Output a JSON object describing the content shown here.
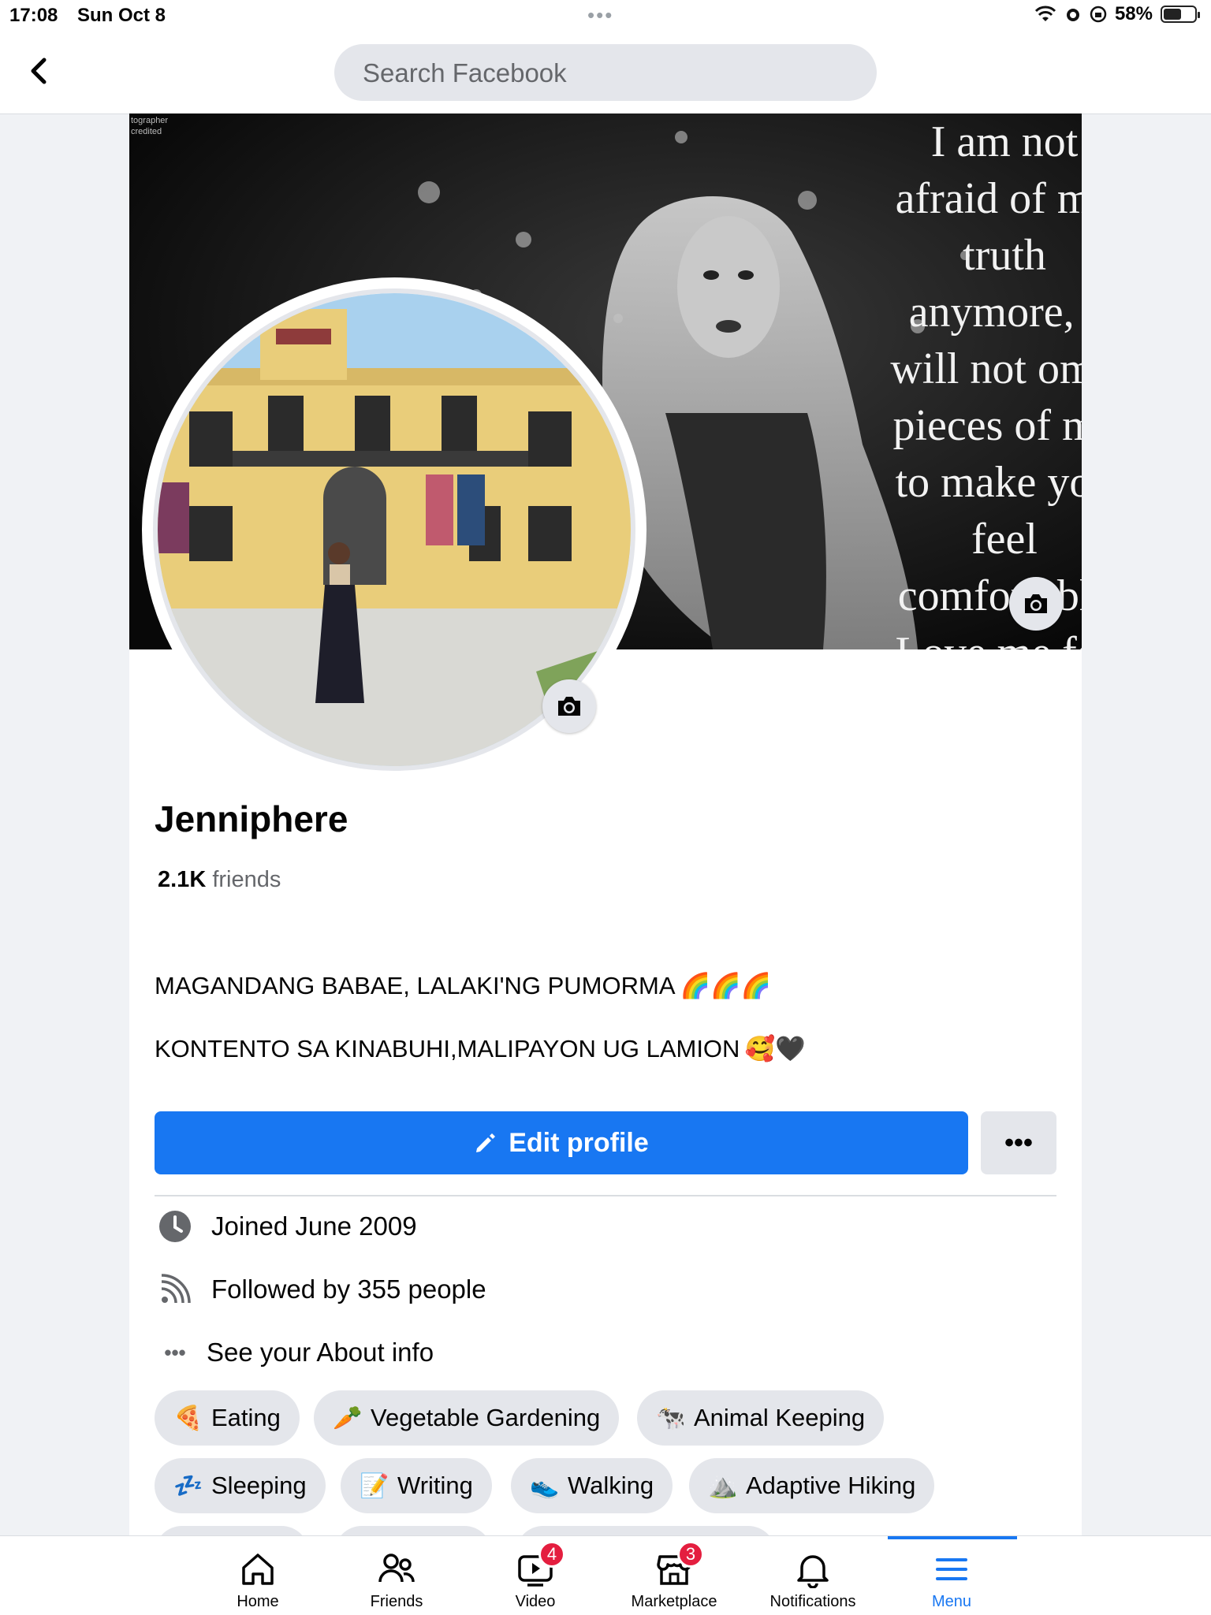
{
  "status_bar": {
    "time": "17:08",
    "date": "Sun Oct 8",
    "battery": "58%",
    "battery_level": 0.58
  },
  "nav": {
    "search_placeholder": "Search Facebook",
    "back_icon": "chevron-left-icon"
  },
  "cover": {
    "credit": "tographer\ncredited",
    "quote": "I am not\nafraid of my\ntruth\nanymore, I\nwill not omit\npieces of me\nto make you\nfeel\ncomfortable\nLove me for"
  },
  "profile": {
    "name": "Jenniphere",
    "friends_count": "2.1K",
    "friends_label": "friends",
    "bio_line1": "MAGANDANG BABAE, LALAKI'NG PUMORMA",
    "bio_line1_emoji": "🌈🌈🌈",
    "bio_line2": "KONTENTO SA KINABUHI,MALIPAYON UG LAMION",
    "bio_line2_emoji": "🥰🖤"
  },
  "actions": {
    "edit_profile": "Edit profile",
    "more": "•••"
  },
  "details": {
    "joined": "Joined June 2009",
    "followers": "Followed by 355 people",
    "about": "See your About info"
  },
  "hobbies": [
    {
      "emoji": "🍕",
      "label": "Eating"
    },
    {
      "emoji": "🥕",
      "label": "Vegetable Gardening"
    },
    {
      "emoji": "🐄",
      "label": "Animal Keeping"
    },
    {
      "emoji": "💤",
      "label": "Sleeping"
    },
    {
      "emoji": "📝",
      "label": "Writing"
    },
    {
      "emoji": "👟",
      "label": "Walking"
    },
    {
      "emoji": "⛰️",
      "label": "Adaptive Hiking"
    }
  ],
  "tabs": [
    {
      "label": "Home",
      "icon": "home-icon",
      "badge": ""
    },
    {
      "label": "Friends",
      "icon": "friends-icon",
      "badge": ""
    },
    {
      "label": "Video",
      "icon": "video-icon",
      "badge": "4"
    },
    {
      "label": "Marketplace",
      "icon": "marketplace-icon",
      "badge": "3"
    },
    {
      "label": "Notifications",
      "icon": "bell-icon",
      "badge": ""
    },
    {
      "label": "Menu",
      "icon": "menu-icon",
      "badge": ""
    }
  ],
  "colors": {
    "accent": "#1877f2",
    "badge": "#e41e3f",
    "chip_bg": "#e4e6eb"
  }
}
